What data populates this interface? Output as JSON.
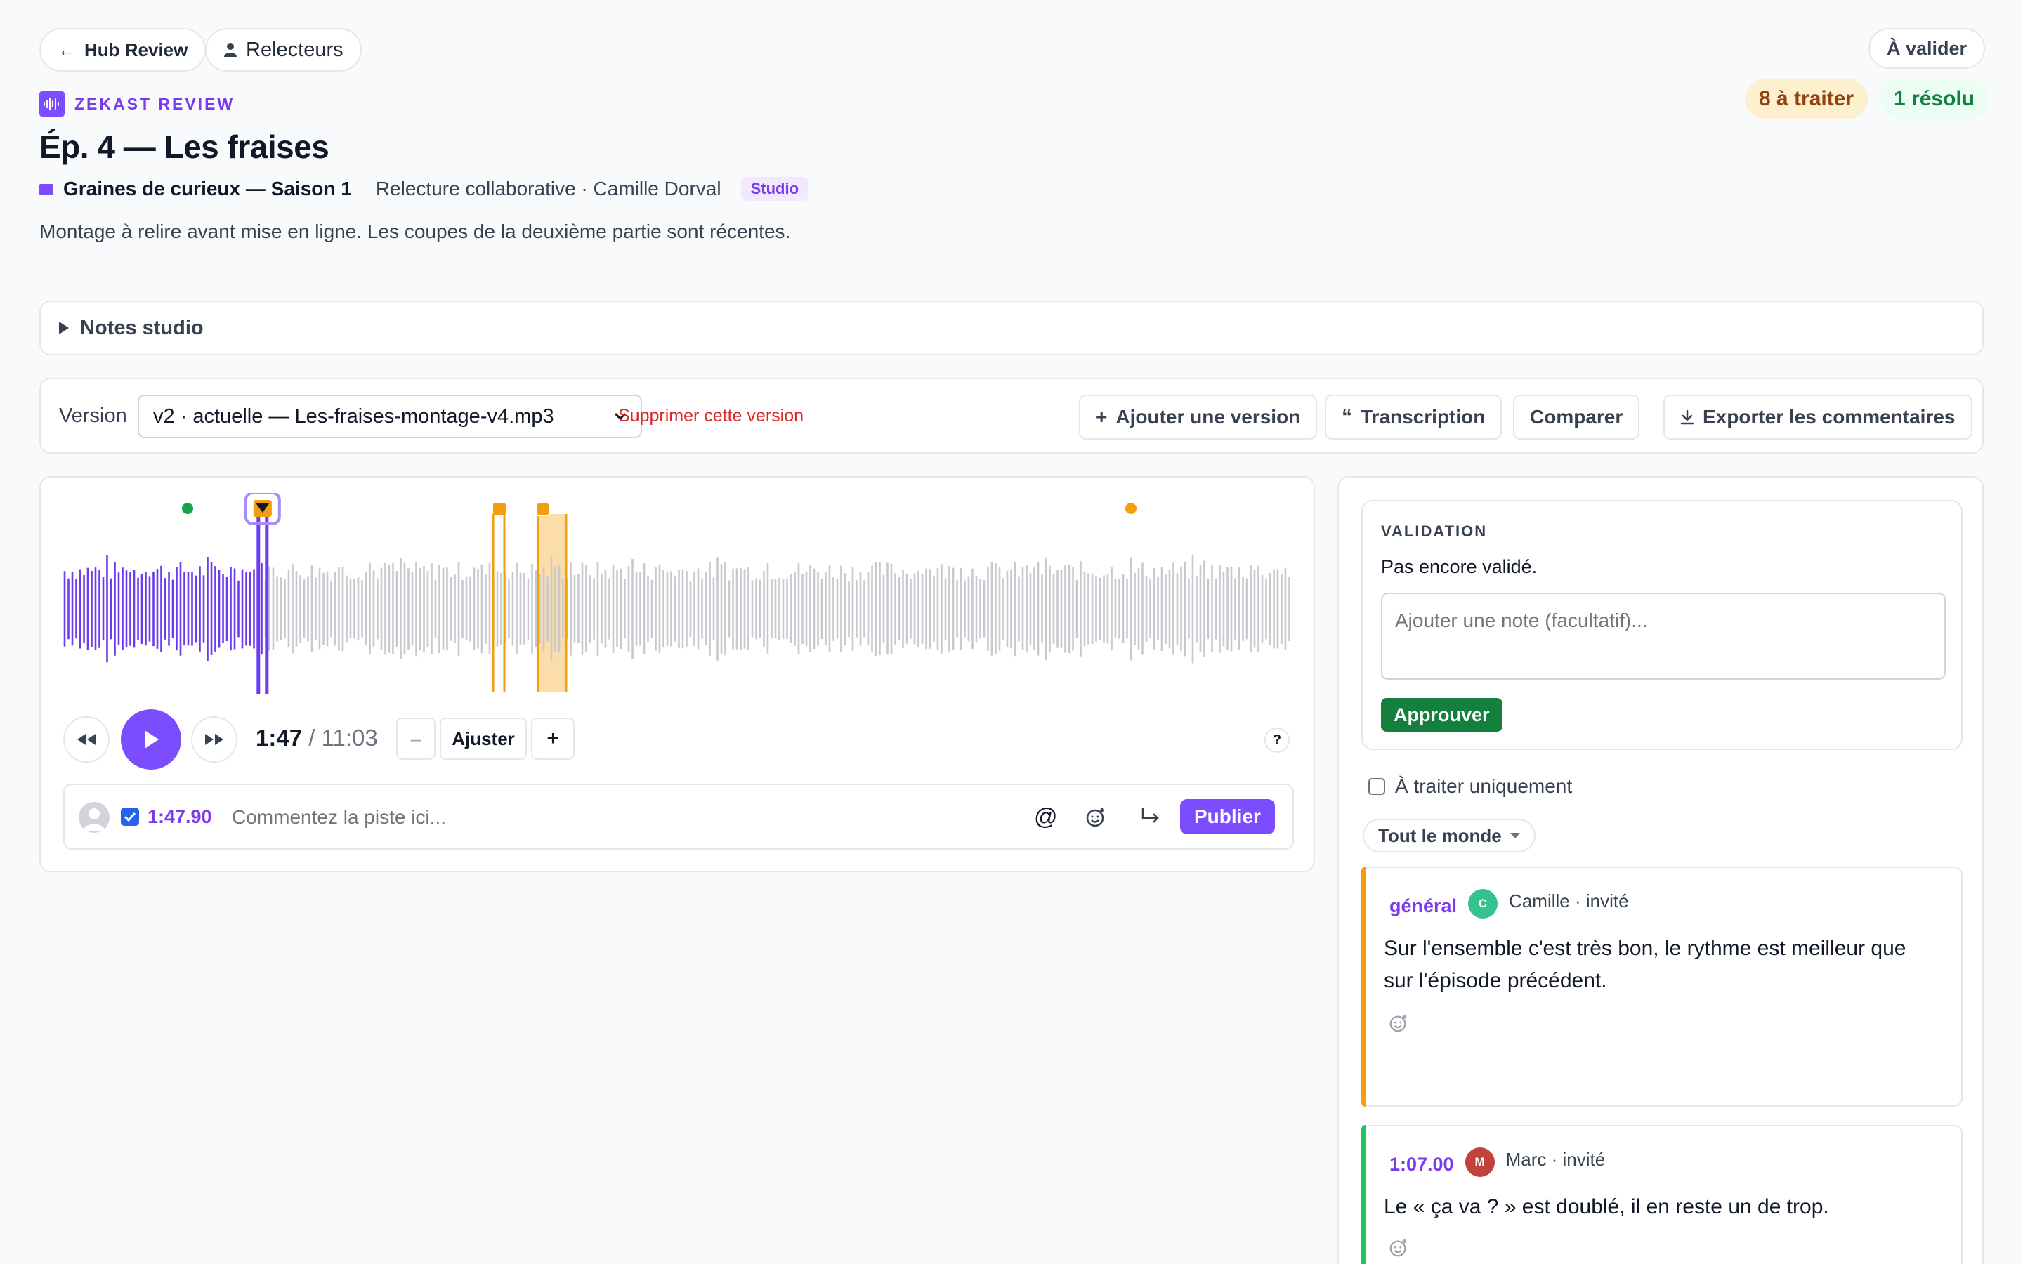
{
  "nav": {
    "back_label": "Hub Review",
    "reviewers_label": "Relecteurs",
    "status_label": "À valider"
  },
  "brand": {
    "name": "ZEKAST REVIEW"
  },
  "episode": {
    "title": "Ép. 4 — Les fraises",
    "season": "Graines de curieux — Saison 1",
    "subtitle": "Relecture collaborative · Camille Dorval",
    "badge": "Studio",
    "description": "Montage à relire avant mise en ligne. Les coupes de la deuxième partie sont récentes."
  },
  "counts": {
    "pending": "8 à traiter",
    "resolved": "1 résolu"
  },
  "notes": {
    "label": "Notes studio"
  },
  "toolbar": {
    "version_label": "Version",
    "version_selected": "v2 · actuelle — Les-fraises-montage-v4.mp3",
    "delete_label": "Supprimer cette version",
    "add_version": "Ajouter une version",
    "transcription": "Transcription",
    "compare": "Comparer",
    "export": "Exporter les commentaires"
  },
  "player": {
    "current_time": "1:47",
    "separator": "/",
    "duration": "11:03",
    "progress": 0.162,
    "zoom_minus": "–",
    "zoom_fit": "Ajuster",
    "zoom_plus": "+",
    "help": "?"
  },
  "composer": {
    "timestamp": "1:47.90",
    "placeholder": "Commentez la piste ici...",
    "mention": "@",
    "publish": "Publier"
  },
  "validation": {
    "title": "VALIDATION",
    "state": "Pas encore validé.",
    "note_placeholder": "Ajouter une note (facultatif)...",
    "approve": "Approuver"
  },
  "filters": {
    "pending_only": "À traiter uniquement",
    "audience": "Tout le monde"
  },
  "comments": [
    {
      "tag": "général",
      "initial": "C",
      "author": "Camille · invité",
      "text": "Sur l'ensemble c'est très bon, le rythme est meilleur que sur l'épisode précédent.",
      "avatar_color": "#34c38f",
      "accent": "#f59e0b"
    },
    {
      "tag": "1:07.00",
      "initial": "M",
      "author": "Marc · invité",
      "text": "Le « ça va ? » est doublé, il en reste un de trop.",
      "avatar_color": "#c2413d",
      "accent": "#22c55e"
    }
  ],
  "colors": {
    "accent": "#7c4dff",
    "waveform_played": "#6a3bef",
    "waveform_rest": "#c7c9cf",
    "marker_orange": "#f59e0b",
    "marker_green": "#16a34a"
  }
}
